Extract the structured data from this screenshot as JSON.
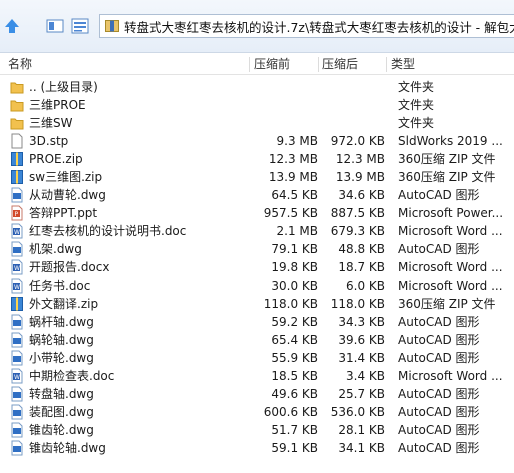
{
  "address": {
    "path": "转盘式大枣红枣去核机的设计.7z\\转盘式大枣红枣去核机的设计 - 解包大小"
  },
  "columns": {
    "name": "名称",
    "size": "压缩前",
    "packed": "压缩后",
    "type": "类型"
  },
  "rows": [
    {
      "name": ".. (上级目录)",
      "size": "",
      "packed": "",
      "type": "文件夹",
      "icon": "folder-up-icon"
    },
    {
      "name": "三维PROE",
      "size": "",
      "packed": "",
      "type": "文件夹",
      "icon": "folder-icon"
    },
    {
      "name": "三维SW",
      "size": "",
      "packed": "",
      "type": "文件夹",
      "icon": "folder-icon"
    },
    {
      "name": "3D.stp",
      "size": "9.3 MB",
      "packed": "972.0 KB",
      "type": "SldWorks 2019 ...",
      "icon": "file-icon"
    },
    {
      "name": "PROE.zip",
      "size": "12.3 MB",
      "packed": "12.3 MB",
      "type": "360压缩 ZIP 文件",
      "icon": "zip-icon"
    },
    {
      "name": "sw三维图.zip",
      "size": "13.9 MB",
      "packed": "13.9 MB",
      "type": "360压缩 ZIP 文件",
      "icon": "zip-icon"
    },
    {
      "name": "从动曹轮.dwg",
      "size": "64.5 KB",
      "packed": "34.6 KB",
      "type": "AutoCAD 图形",
      "icon": "dwg-icon"
    },
    {
      "name": "答辩PPT.ppt",
      "size": "957.5 KB",
      "packed": "887.5 KB",
      "type": "Microsoft Power...",
      "icon": "ppt-icon"
    },
    {
      "name": "红枣去核机的设计说明书.doc",
      "size": "2.1 MB",
      "packed": "679.3 KB",
      "type": "Microsoft Word ...",
      "icon": "doc-icon"
    },
    {
      "name": "机架.dwg",
      "size": "79.1 KB",
      "packed": "48.8 KB",
      "type": "AutoCAD 图形",
      "icon": "dwg-icon"
    },
    {
      "name": "开题报告.docx",
      "size": "19.8 KB",
      "packed": "18.7 KB",
      "type": "Microsoft Word ...",
      "icon": "doc-icon"
    },
    {
      "name": "任务书.doc",
      "size": "30.0 KB",
      "packed": "6.0 KB",
      "type": "Microsoft Word ...",
      "icon": "doc-icon"
    },
    {
      "name": "外文翻译.zip",
      "size": "118.0 KB",
      "packed": "118.0 KB",
      "type": "360压缩 ZIP 文件",
      "icon": "zip-icon"
    },
    {
      "name": "蜗杆轴.dwg",
      "size": "59.2 KB",
      "packed": "34.3 KB",
      "type": "AutoCAD 图形",
      "icon": "dwg-icon"
    },
    {
      "name": "蜗轮轴.dwg",
      "size": "65.4 KB",
      "packed": "39.6 KB",
      "type": "AutoCAD 图形",
      "icon": "dwg-icon"
    },
    {
      "name": "小带轮.dwg",
      "size": "55.9 KB",
      "packed": "31.4 KB",
      "type": "AutoCAD 图形",
      "icon": "dwg-icon"
    },
    {
      "name": "中期检查表.doc",
      "size": "18.5 KB",
      "packed": "3.4 KB",
      "type": "Microsoft Word ...",
      "icon": "doc-icon"
    },
    {
      "name": "转盘轴.dwg",
      "size": "49.6 KB",
      "packed": "25.7 KB",
      "type": "AutoCAD 图形",
      "icon": "dwg-icon"
    },
    {
      "name": "装配图.dwg",
      "size": "600.6 KB",
      "packed": "536.0 KB",
      "type": "AutoCAD 图形",
      "icon": "dwg-icon"
    },
    {
      "name": "锥齿轮.dwg",
      "size": "51.7 KB",
      "packed": "28.1 KB",
      "type": "AutoCAD 图形",
      "icon": "dwg-icon"
    },
    {
      "name": "锥齿轮轴.dwg",
      "size": "59.1 KB",
      "packed": "34.1 KB",
      "type": "AutoCAD 图形",
      "icon": "dwg-icon"
    }
  ]
}
